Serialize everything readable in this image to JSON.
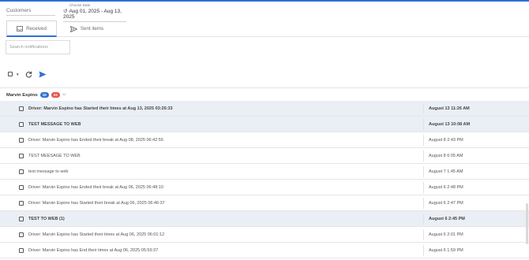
{
  "filters": {
    "customers_placeholder": "Customers",
    "date_label": "Choose Date",
    "date_range": "Aug 01, 2025 - Aug 13, 2025"
  },
  "tabs": [
    {
      "label": "Received",
      "icon": "inbox-icon",
      "active": true
    },
    {
      "label": "Sent items",
      "icon": "send-icon",
      "active": false
    }
  ],
  "search": {
    "placeholder": "Search notifications"
  },
  "toolbar": {
    "icons": [
      "select-all-checkbox",
      "caret-down-icon",
      "refresh-icon",
      "send-icon"
    ]
  },
  "group": {
    "name": "Marvin Espino",
    "count_total": "19",
    "count_unread": "03"
  },
  "colors": {
    "accent": "#2f6fd6",
    "badge_blue": "#2e72d2",
    "badge_red": "#e5534b",
    "unread_row": "#eaeef5"
  },
  "messages": [
    {
      "text": "Driver: Marvin Espino has Started their times at Aug 13, 2025 03:26:33",
      "time": "August 13 11:26 AM",
      "unread": true
    },
    {
      "text": "TEST MESSAGE TO WEB",
      "time": "August 13 10:08 AM",
      "unread": true
    },
    {
      "text": "Driver: Marvin Espino has Ended their break at Aug 08, 2025 06:42:55",
      "time": "August 8 2:43 PM",
      "unread": false
    },
    {
      "text": "TEST MEESAGE TO WEB",
      "time": "August 8 6:05 AM",
      "unread": false
    },
    {
      "text": "test message to web",
      "time": "August 7 1:45 AM",
      "unread": false
    },
    {
      "text": "Driver: Marvin Espino has Ended their break at Aug 06, 2025 06:48:10",
      "time": "August 6 2:48 PM",
      "unread": false
    },
    {
      "text": "Driver: Marvin Espino has Started their break at Aug 06, 2025 06:46:37",
      "time": "August 6 2:47 PM",
      "unread": false
    },
    {
      "text": "TEST TO WEB (1)",
      "time": "August 6 2:45 PM",
      "unread": true
    },
    {
      "text": "Driver: Marvin Espino has Started their times at Aug 06, 2025 06:01:12",
      "time": "August 6 2:01 PM",
      "unread": false
    },
    {
      "text": "Driver: Marvin Espino has End their times at Aug 06, 2025 05:59:37",
      "time": "August 6 1:59 PM",
      "unread": false
    }
  ]
}
